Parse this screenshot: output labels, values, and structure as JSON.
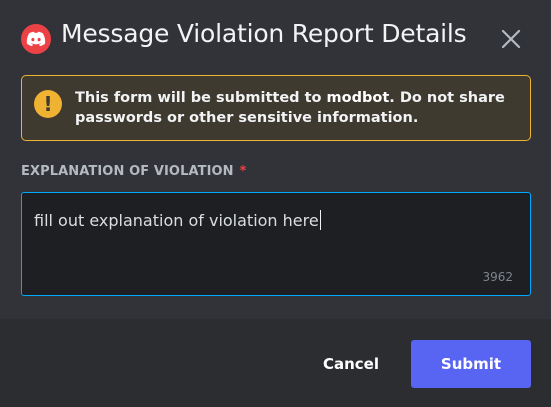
{
  "dialog": {
    "title": "Message Violation Report Details",
    "logo_icon": "discord-logo-icon",
    "close_icon": "close-icon"
  },
  "notice": {
    "icon": "warning-icon",
    "icon_glyph": "!",
    "text_before": "This form will be submitted to ",
    "bot_name": "modbot",
    "text_after": ". Do not share passwords or other sensitive information."
  },
  "field": {
    "label": "EXPLANATION OF VIOLATION",
    "required_marker": "*",
    "value": "fill out explanation of violation here",
    "remaining_chars": "3962"
  },
  "footer": {
    "cancel_label": "Cancel",
    "submit_label": "Submit"
  },
  "colors": {
    "background": "#313338",
    "footer": "#2b2d31",
    "warning": "#f0b232",
    "input_focus": "#00a8fc",
    "primary_button": "#5865f2",
    "logo": "#ed4245"
  }
}
